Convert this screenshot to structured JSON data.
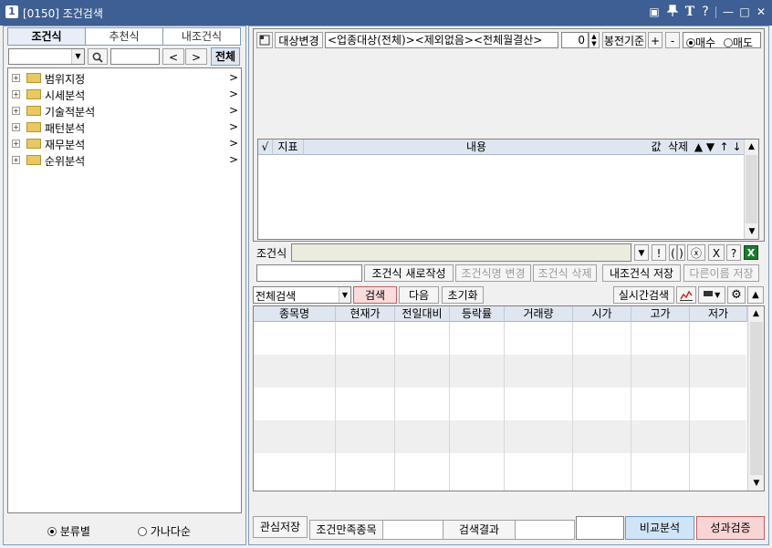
{
  "window": {
    "number": "1",
    "title": "[0150]  조건검색"
  },
  "titlebar_icons": [
    "layout-icon",
    "pin-icon",
    "font-icon",
    "help-icon",
    "minimize-icon",
    "maximize-icon",
    "close-icon"
  ],
  "titlebar_glyphs": {
    "layout": "▣",
    "pin": "🖈",
    "font": "T",
    "help": "?",
    "minimize": "—",
    "maximize": "□",
    "close": "✕"
  },
  "left": {
    "tabs": [
      "조건식",
      "추천식",
      "내조건식"
    ],
    "active_tab": 0,
    "search": {
      "value": "",
      "value2": "",
      "all_label": "전체",
      "prev": "<",
      "next": ">"
    },
    "tree": [
      "범위지정",
      "시세분석",
      "기술적분석",
      "패턴분석",
      "재무분석",
      "순위분석"
    ],
    "tree_arrow": ">",
    "radios": {
      "by_category": "분류별",
      "alphabetical": "가나다순",
      "selected": "by_category"
    }
  },
  "right": {
    "target_button": "대상변경",
    "target_text": "<업종대상(전체)><제외없음><전체월결산>",
    "candle_value": "0",
    "candle_label": "봉전기준",
    "plus": "+",
    "minus": "-",
    "trade_type": {
      "buy": "매수",
      "sell": "매도",
      "selected": "buy"
    },
    "condition_grid": {
      "headers": [
        "√",
        "지표",
        "내용",
        "값",
        "삭제",
        "▲",
        "▼",
        "↑",
        "↓"
      ]
    },
    "condition_label": "조건식",
    "condition_value": "",
    "op_buttons": [
      "▼",
      "!",
      "(",
      ")",
      "ⓧ",
      "X",
      "?"
    ],
    "excel_icon": "X",
    "name_input": "",
    "actions": {
      "new": "조건식 새로작성",
      "rename": "조건식명 변경",
      "delete": "조건식 삭제",
      "save": "내조건식 저장",
      "save_as": "다른이름 저장"
    },
    "search_type": "전체검색",
    "search_btn": "검색",
    "next_btn": "다음",
    "reset_btn": "초기화",
    "realtime_btn": "실시간검색",
    "results": {
      "headers": [
        "종목명",
        "현재가",
        "전일대비",
        "등락률",
        "거래량",
        "시가",
        "고가",
        "저가"
      ],
      "rows": 5
    },
    "footer": {
      "watch_save": "관심저장",
      "matched_label": "조건만족종목",
      "matched_value": "",
      "result_label": "검색결과",
      "result_value": "",
      "compare": "비교분석",
      "verify": "성과검증"
    }
  },
  "colors": {
    "titlebar": "#3e5f93",
    "header": "#dfe6ef",
    "search_btn": "#fadcdc",
    "compare": "#cfe4f7",
    "verify": "#f9d4d4"
  }
}
